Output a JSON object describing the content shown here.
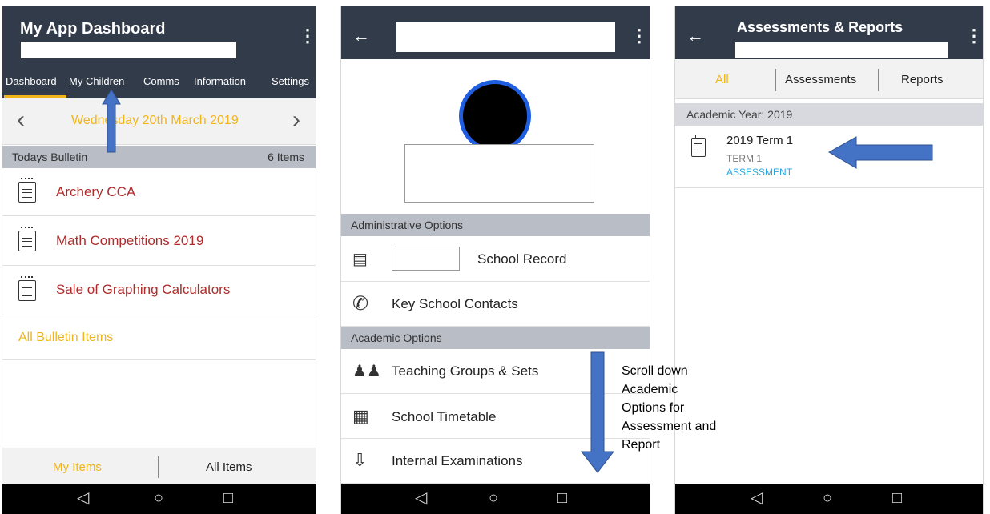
{
  "panel1": {
    "title": "My App Dashboard",
    "tabs": [
      "Dashboard",
      "My Children",
      "Comms",
      "Information",
      "Settings"
    ],
    "date": "Wednesday 20th March 2019",
    "bulletin": {
      "label": "Todays Bulletin",
      "count": "6 Items"
    },
    "items": [
      "Archery CCA",
      "Math Competitions 2019",
      "Sale of Graphing Calculators"
    ],
    "all_link": "All Bulletin Items",
    "bottom_tabs": [
      "My Items",
      "All Items"
    ]
  },
  "panel2": {
    "section_admin": "Administrative Options",
    "admin_items": [
      "School Record",
      "Key School Contacts"
    ],
    "section_academic": "Academic Options",
    "academic_items": [
      "Teaching Groups & Sets",
      "School Timetable",
      "Internal Examinations"
    ]
  },
  "panel3": {
    "title": "Assessments & Reports",
    "segments": [
      "All",
      "Assessments",
      "Reports"
    ],
    "year_label": "Academic Year: 2019",
    "entry": {
      "title": "2019 Term 1",
      "sub": "TERM 1",
      "type": "ASSESSMENT"
    }
  },
  "annotation": "Scroll down Academic Options for Assessment and Report",
  "colors": {
    "appbar": "#323b4a",
    "accent": "#f1b51c",
    "item_red": "#b02b2b",
    "arrow": "#4472c4",
    "link_blue": "#2aa7e0"
  }
}
